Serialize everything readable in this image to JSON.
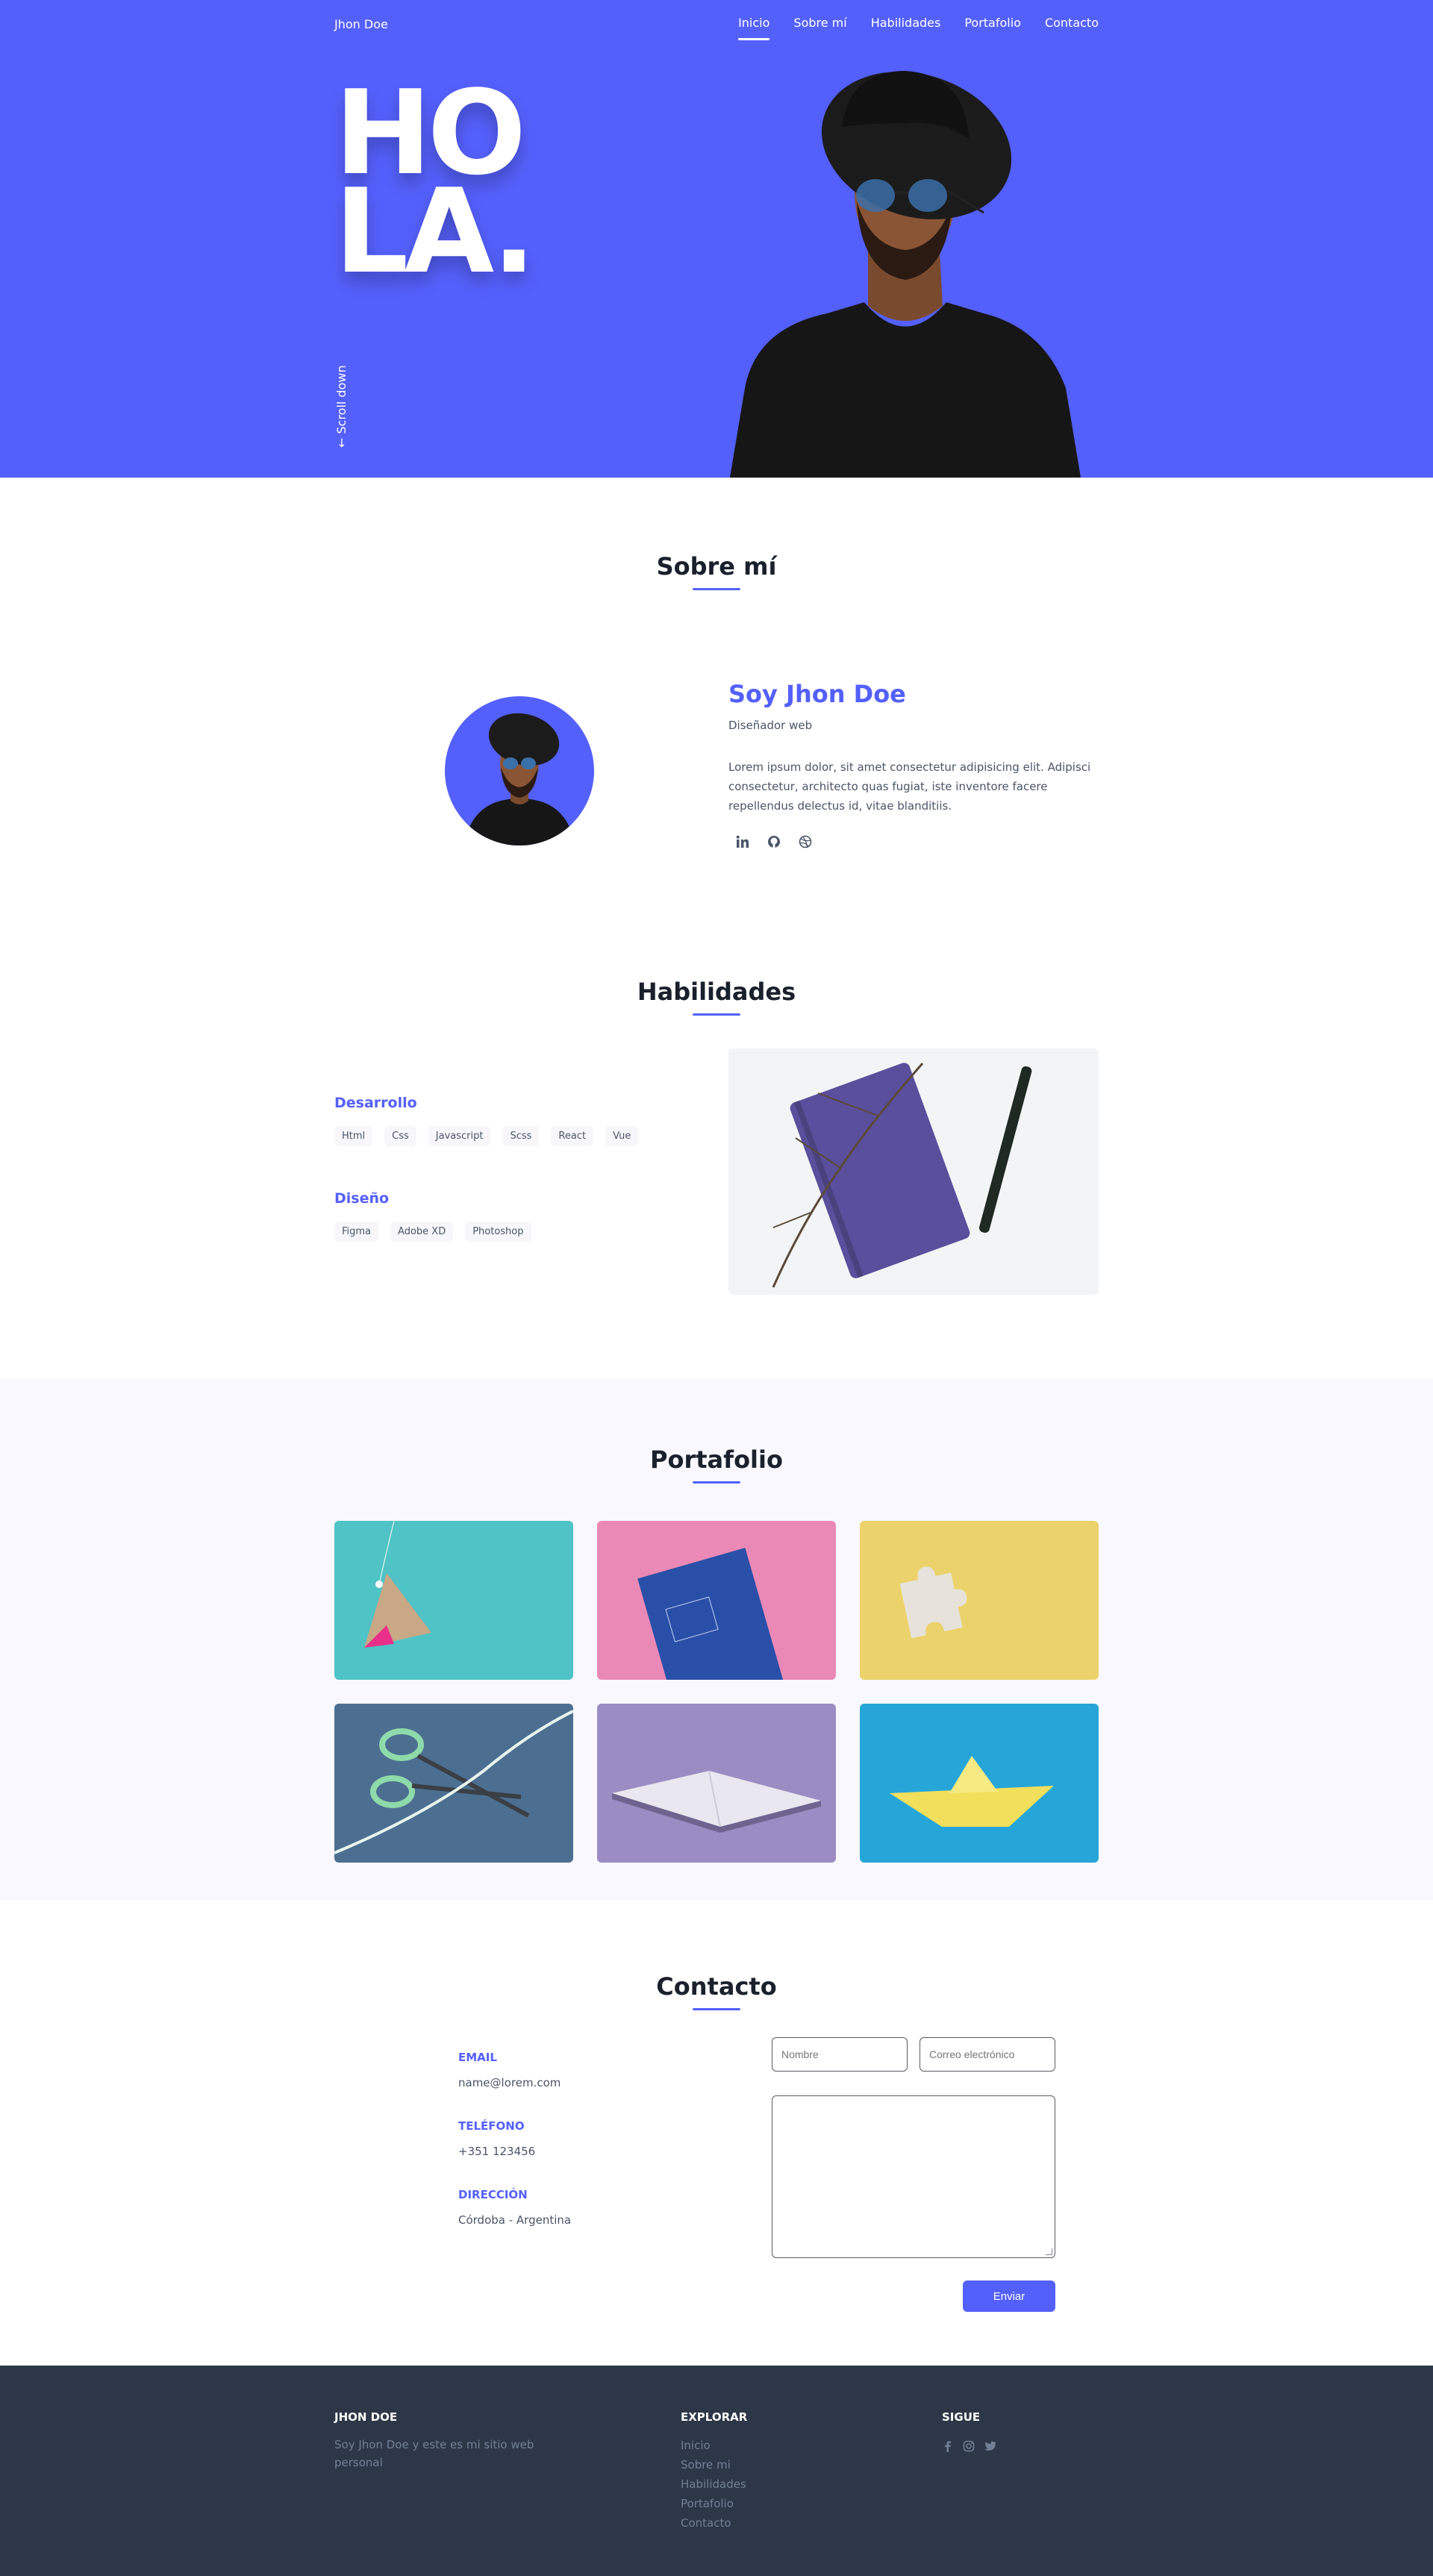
{
  "nav": {
    "brand": "Jhon Doe",
    "items": [
      "Inicio",
      "Sobre mí",
      "Habilidades",
      "Portafolio",
      "Contacto"
    ]
  },
  "hero": {
    "line1": "HO",
    "line2": "LA.",
    "scroll": "← Scroll down",
    "colors": {
      "background": "#5460fb"
    }
  },
  "about": {
    "title": "Sobre mí",
    "name": "Soy Jhon Doe",
    "role": "Diseñador web",
    "description": "Lorem ipsum dolor, sit amet consectetur adipisicing elit. Adipisci consectetur, architecto quas fugiat, iste inventore facere repellendus delectus id, vitae blanditiis.",
    "socials": [
      "linkedin-icon",
      "github-icon",
      "dribbble-icon"
    ]
  },
  "skills": {
    "title": "Habilidades",
    "groups": [
      {
        "name": "Desarrollo",
        "tags": [
          "Html",
          "Css",
          "Javascript",
          "Scss",
          "React",
          "Vue"
        ]
      },
      {
        "name": "Diseño",
        "tags": [
          "Figma",
          "Adobe XD",
          "Photoshop"
        ]
      }
    ]
  },
  "portfolio": {
    "title": "Portafolio",
    "items": [
      {
        "alt": "tag on teal",
        "bg": "#4fc3c6"
      },
      {
        "alt": "book on pink",
        "bg": "#ea89b6"
      },
      {
        "alt": "puzzle piece on yellow",
        "bg": "#ecd26a"
      },
      {
        "alt": "scissors on blue",
        "bg": "#4c6f91"
      },
      {
        "alt": "open book on purple",
        "bg": "#9b8cc4"
      },
      {
        "alt": "paper boat on blue",
        "bg": "#26a6d8"
      }
    ]
  },
  "contact": {
    "title": "Contacto",
    "email_label": "EMAIL",
    "email": "name@lorem.com",
    "phone_label": "TELÉFONO",
    "phone": "+351 123456",
    "address_label": "DIRECCIÓN",
    "address": "Córdoba - Argentina",
    "name_placeholder": "Nombre",
    "email_placeholder": "Correo electrónico",
    "send": "Enviar"
  },
  "footer": {
    "brand": "JHON DOE",
    "about": "Soy Jhon Doe y este es mi sitio web personal",
    "explore_title": "EXPLORAR",
    "links": [
      "Inicio",
      "Sobre mi",
      "Habilidades",
      "Portafolio",
      "Contacto"
    ],
    "follow_title": "SIGUE",
    "icons": [
      "facebook-icon",
      "instagram-icon",
      "twitter-icon"
    ]
  }
}
